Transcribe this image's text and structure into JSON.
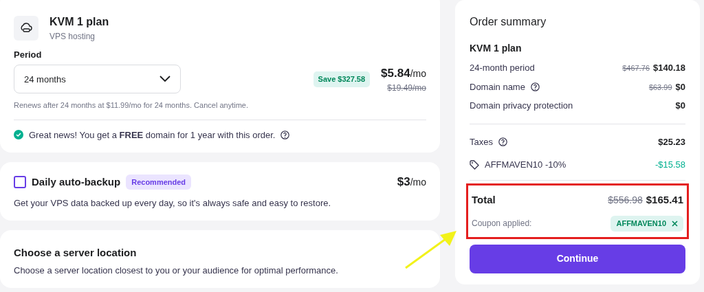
{
  "plan": {
    "title": "KVM 1 plan",
    "subtitle": "VPS hosting"
  },
  "period": {
    "label": "Period",
    "value": "24 months",
    "save_badge": "Save $327.58",
    "price": "$5.84",
    "price_unit": "/mo",
    "old_price": "$19.49/mo",
    "renew_note": "Renews after 24 months at $11.99/mo for 24 months. Cancel anytime."
  },
  "notice": {
    "text": "Great news! You get a **FREE** domain for 1 year with this order.",
    "help": true
  },
  "backup": {
    "title": "Daily auto-backup",
    "checked": false,
    "badge": "Recommended",
    "price": "$3",
    "price_unit": "/mo",
    "description": "Get your VPS data backed up every day, so it's always safe and easy to restore."
  },
  "location": {
    "title": "Choose a server location",
    "description": "Choose a server location closest to you or your audience for optimal performance."
  },
  "summary": {
    "title": "Order summary",
    "plan": "KVM 1 plan",
    "items": [
      {
        "label": "24-month period",
        "help": false,
        "old_price": "$467.76",
        "price": "$140.18"
      },
      {
        "label": "Domain name",
        "help": true,
        "old_price": "$63.99",
        "price": "$0"
      },
      {
        "label": "Domain privacy protection",
        "help": false,
        "price": "$0"
      }
    ],
    "adjustments": [
      {
        "kind": "tax",
        "label": "Taxes",
        "help": true,
        "price": "$25.23"
      },
      {
        "kind": "discount",
        "label": "AFFMAVEN10 -10%",
        "help": false,
        "price": "-$15.58"
      }
    ],
    "total": {
      "label": "Total",
      "old_price": "$556.98",
      "price": "$165.41",
      "highlighted": true,
      "coupon_label": "Coupon applied:",
      "coupon_code": "AFFMAVEN10"
    },
    "button": "Continue"
  }
}
